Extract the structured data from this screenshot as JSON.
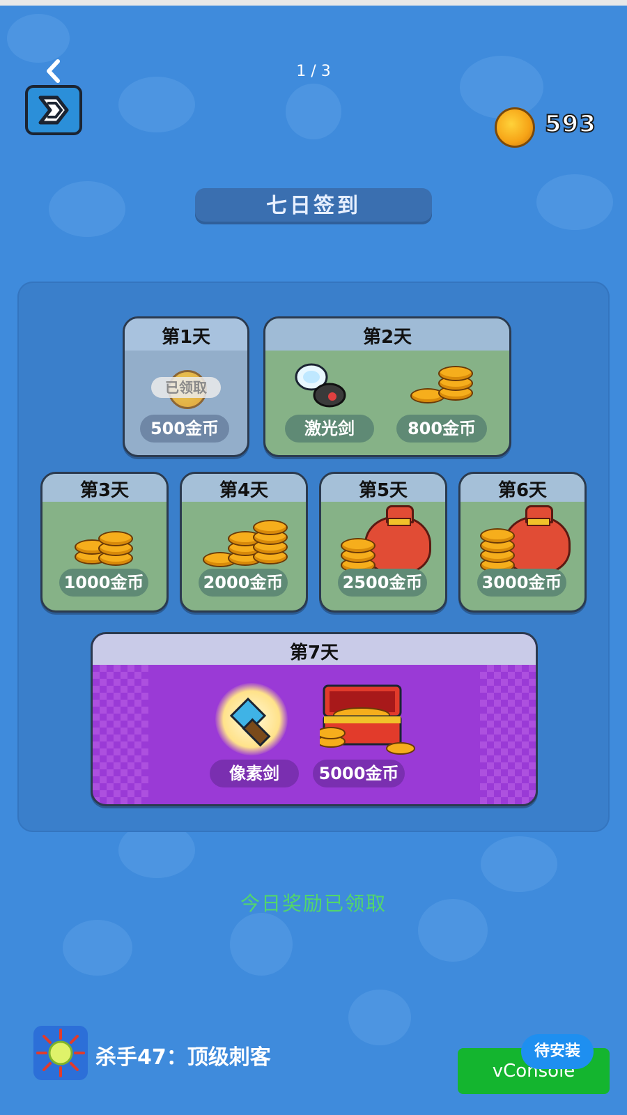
{
  "header": {
    "back_icon": "chevron-left-icon",
    "page_indicator": "1 / 3",
    "exit_icon": "exit-arrow-icon"
  },
  "currency": {
    "icon": "gold-coin-icon",
    "amount": "593"
  },
  "title": "七日签到",
  "days": [
    {
      "label": "第1天",
      "rewards": [
        "500金币"
      ],
      "badge": "已领取",
      "claimed": true
    },
    {
      "label": "第2天",
      "rewards": [
        "激光剑",
        "800金币"
      ]
    },
    {
      "label": "第3天",
      "rewards": [
        "1000金币"
      ]
    },
    {
      "label": "第4天",
      "rewards": [
        "2000金币"
      ]
    },
    {
      "label": "第5天",
      "rewards": [
        "2500金币"
      ]
    },
    {
      "label": "第6天",
      "rewards": [
        "3000金币"
      ]
    },
    {
      "label": "第7天",
      "rewards": [
        "像素剑",
        "5000金币"
      ]
    }
  ],
  "status_text": "今日奖励已领取",
  "ad": {
    "title": "杀手47：顶级刺客",
    "install_label": "待安装"
  },
  "vconsole_label": "vConsole",
  "colors": {
    "background": "#3f8bdc",
    "status_green": "#52d66b",
    "day7_purple": "#9a3ad6",
    "vconsole_green": "#14b52f",
    "install_blue": "#1e8ff0"
  }
}
